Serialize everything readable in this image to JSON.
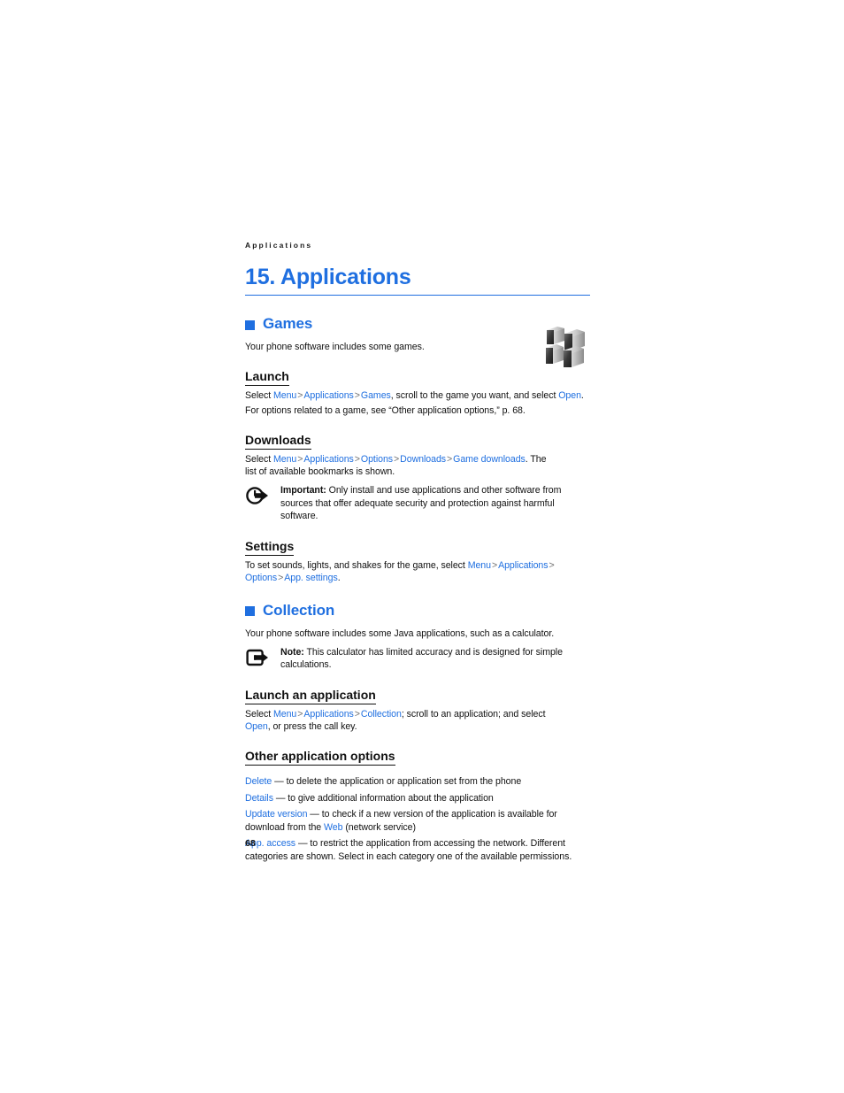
{
  "document": {
    "running_header": "Applications",
    "chapter_title": "15. Applications",
    "page_number": "68",
    "accent_color": "#1f6fe0",
    "text_color": "#111111"
  },
  "sections": {
    "games": {
      "heading": "Games",
      "bullet_icon": "square-bullet-icon",
      "intro": "Your phone software includes some games.",
      "icon": "games-cubes-icon",
      "launch": {
        "heading": "Launch",
        "line1": {
          "prefix": "Select ",
          "link1": "Menu",
          "sep1": ">",
          "link2": "Applications",
          "sep2": ">",
          "link3": "Games",
          "middle": ", scroll to the game you want, and select ",
          "link4": "Open",
          "suffix": "."
        },
        "line2": "For options related to a game, see “Other application options,” p. 68."
      },
      "downloads": {
        "heading": "Downloads",
        "line1": {
          "prefix": "Select ",
          "link1": "Menu",
          "sep1": ">",
          "link2": "Applications",
          "sep2": ">",
          "link3": "Options",
          "sep3": ">",
          "link4": "Downloads",
          "sep4": ">",
          "link5": "Game downloads",
          "suffix": ". The"
        },
        "line2": "list of available bookmarks is shown.",
        "callout": {
          "icon": "important-circle-arrow-icon",
          "label": "Important:",
          "text": " Only install and use applications and other software from sources that offer adequate security and protection against harmful software."
        }
      },
      "settings": {
        "heading": "Settings",
        "line1": {
          "prefix": "To set sounds, lights, and shakes for the game, select ",
          "link1": "Menu",
          "sep1": ">",
          "link2": "Applications",
          "sep2": ">"
        },
        "line2": {
          "link1": "Options",
          "sep1": ">",
          "link2": "App. settings",
          "suffix": "."
        }
      }
    },
    "collection": {
      "heading": "Collection",
      "bullet_icon": "square-bullet-icon",
      "intro": "Your phone software includes some Java applications, such as a calculator.",
      "callout": {
        "icon": "note-square-arrow-icon",
        "label": "Note:",
        "text": " This calculator has limited accuracy and is designed for simple calculations."
      },
      "launch_application": {
        "heading": "Launch an application",
        "line1": {
          "prefix": "Select ",
          "link1": "Menu",
          "sep1": ">",
          "link2": "Applications",
          "sep2": ">",
          "link3": "Collection",
          "suffix": "; scroll to an application; and select"
        },
        "line2": {
          "link1": "Open",
          "suffix": ", or press the call key."
        }
      },
      "other_options": {
        "heading": "Other application options",
        "items": [
          {
            "term": "Delete",
            "dash": " — ",
            "description": "to delete the application or application set from the phone"
          },
          {
            "term": "Details",
            "dash": " — ",
            "description": "to give additional information about the application"
          },
          {
            "term": "Update version",
            "dash": " — ",
            "description_pre": "to check if a new version of the application is available for download from the ",
            "link": "Web",
            "description_post": " (network service)"
          },
          {
            "term": "App. access",
            "dash": " — ",
            "description": "to restrict the application from accessing the network. Different categories are shown. Select in each category one of the available permissions."
          }
        ]
      }
    }
  }
}
